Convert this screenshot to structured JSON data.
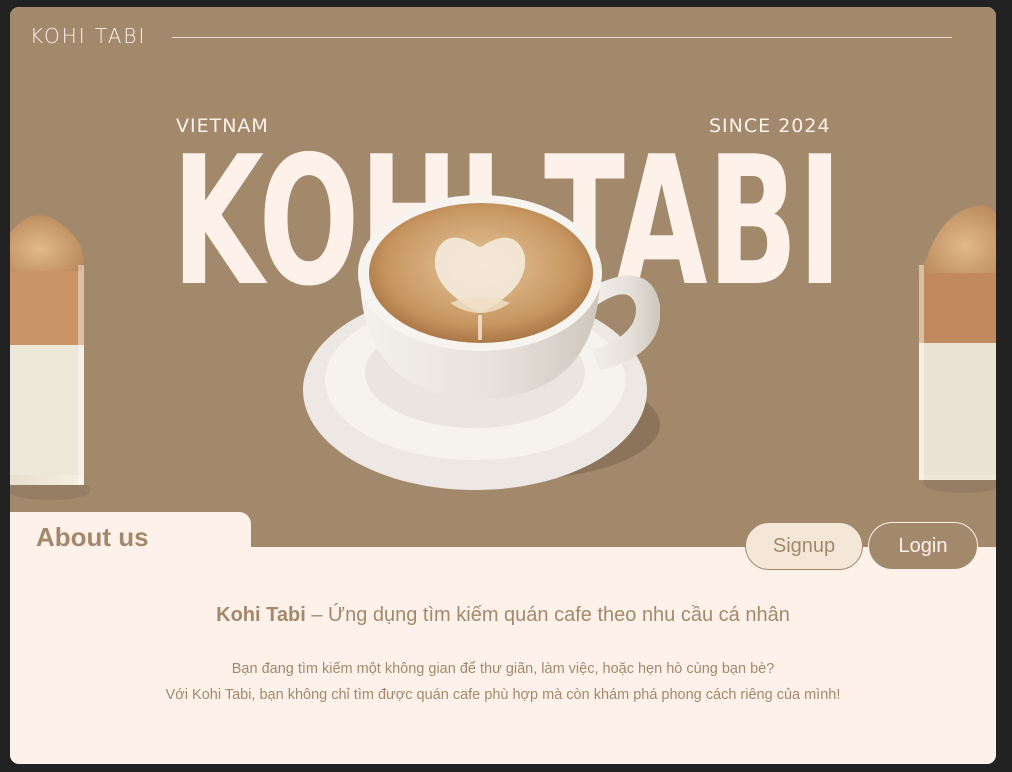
{
  "header": {
    "logo": "KOHI TABI"
  },
  "hero": {
    "tag_left": "VIETNAM",
    "tag_right": "SINCE 2024",
    "big_title": "KOHI TABI",
    "image_center": "latte-cup",
    "image_left": "dalgona-drink",
    "image_right": "dalgona-drink"
  },
  "about": {
    "tab_label": "About us"
  },
  "auth": {
    "signup_label": "Signup",
    "login_label": "Login"
  },
  "content": {
    "brand": "Kohi Tabi",
    "tagline": " – Ứng dụng tìm kiếm quán cafe theo nhu cầu cá nhân",
    "line1": "Bạn đang tìm kiếm một không gian để thư giãn, làm việc, hoặc hẹn hò cùng bạn bè?",
    "line2": "Với Kohi Tabi, bạn không chỉ tìm được quán cafe phù hợp mà còn khám phá phong cách riêng của mình!"
  },
  "colors": {
    "hero_bg": "#A2896C",
    "page_bg": "#FDF1EA",
    "accent": "#A2896C",
    "cream": "#FDF1EA"
  }
}
